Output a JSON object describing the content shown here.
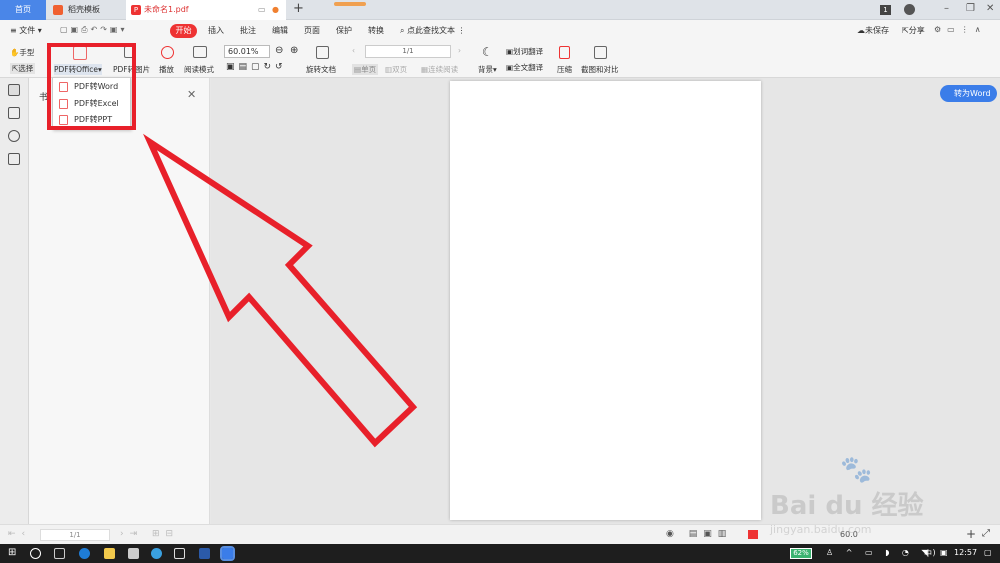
{
  "tabs": {
    "home": "首页",
    "docer": "稻壳模板",
    "file": "未命名1.pdf",
    "badge": "1"
  },
  "menu": {
    "file": "文件",
    "start": "开始",
    "items": [
      "插入",
      "批注",
      "编辑",
      "页面",
      "保护",
      "转换"
    ],
    "search": "点此查找文本",
    "unsaved": "未保存",
    "share": "分享"
  },
  "toolbar": {
    "hand": "手型",
    "select": "选择",
    "pdf_to_office": "PDF转Office",
    "pdf_to_image": "PDF转图片",
    "play": "播放",
    "read_mode": "阅读模式",
    "zoom": "60.01%",
    "rotate_doc": "旋转文档",
    "page_indicator": "1/1",
    "single_page": "单页",
    "double_page": "双页",
    "continuous": "连续阅读",
    "background": "背景",
    "word_translate": "划词翻译",
    "full_translate": "全文翻译",
    "compress": "压缩",
    "screenshot_compare": "截图和对比"
  },
  "dropdown": {
    "items": [
      "PDF转Word",
      "PDF转Excel",
      "PDF转PPT"
    ]
  },
  "panel": {
    "title": "书"
  },
  "to_word_button": "转为Word",
  "statusbar": {
    "page": "1/1",
    "zoom": "60.0"
  },
  "taskbar": {
    "battery": "62%",
    "ime": "中",
    "time": "12:57"
  },
  "watermark": {
    "brand": "Bai du 经验",
    "url": "jingyan.baidu.com"
  },
  "colors": {
    "accent": "#e33333",
    "highlight": "#e8202a",
    "blue": "#3b7de9"
  }
}
